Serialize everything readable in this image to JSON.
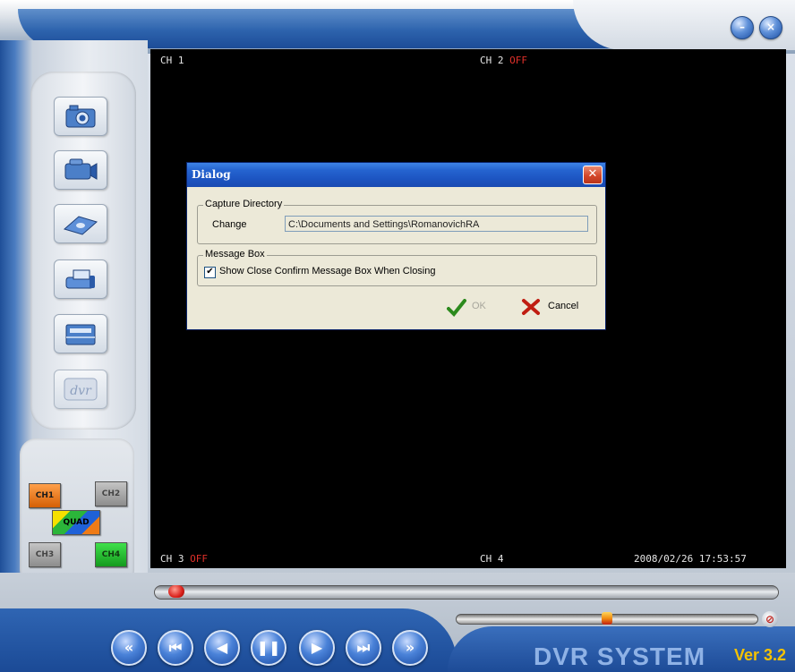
{
  "window": {
    "minimize_icon": "minimize-icon",
    "close_icon": "close-icon"
  },
  "toolbar": {
    "items": [
      {
        "name": "camera-icon"
      },
      {
        "name": "video-camera-icon"
      },
      {
        "name": "disk-icon"
      },
      {
        "name": "printer-icon"
      },
      {
        "name": "folder-icon"
      },
      {
        "name": "dvr-icon",
        "label": "dvr"
      }
    ]
  },
  "channels": {
    "ch1": "CH1",
    "ch2": "CH2",
    "quad": "QUAD",
    "ch3": "CH3",
    "ch4": "CH4"
  },
  "video": {
    "ch1": "CH 1",
    "ch2": "CH 2",
    "ch2_status": "OFF",
    "ch3": "CH 3",
    "ch3_status": "OFF",
    "ch4": "CH 4",
    "timestamp": "2008/02/26 17:53:57"
  },
  "dialog": {
    "title": "Dialog",
    "capture_group": "Capture Directory",
    "change_label": "Change",
    "path": "C:\\Documents and Settings\\RomanovichRA",
    "message_group": "Message Box",
    "checkbox_label": "Show Close Confirm Message Box When Closing",
    "checkbox_checked": true,
    "ok_label": "OK",
    "cancel_label": "Cancel"
  },
  "playback": {
    "buttons": [
      "rewind-icon",
      "skip-back-icon",
      "play-reverse-icon",
      "pause-icon",
      "play-icon",
      "step-forward-icon",
      "fast-forward-icon"
    ]
  },
  "brand": {
    "name": "DVR SYSTEM",
    "version": "Ver 3.2"
  },
  "colors": {
    "accent_blue": "#1c53c0",
    "off_red": "#e0302a",
    "ch1_orange": "#e86a12",
    "ch4_green": "#1fae2a",
    "brand_yellow": "#f5c200"
  }
}
